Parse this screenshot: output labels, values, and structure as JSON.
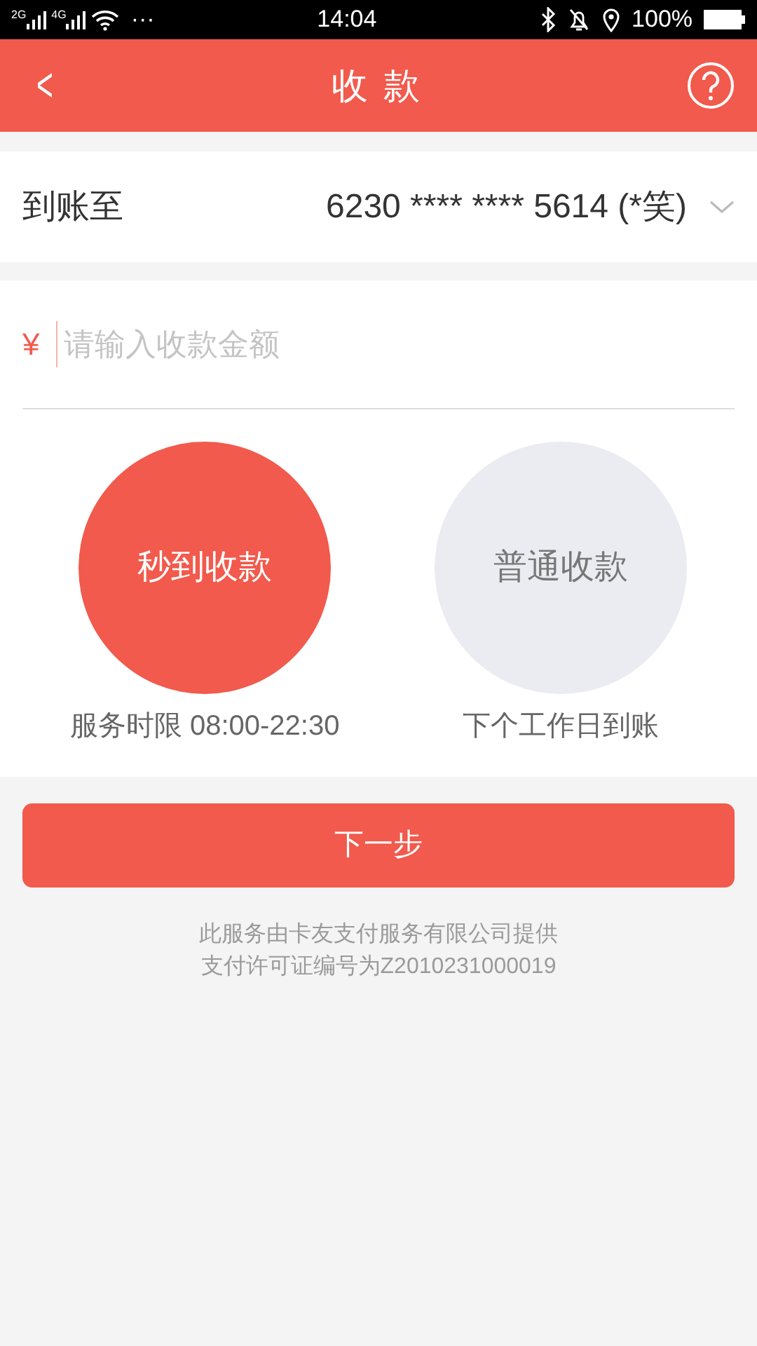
{
  "status_bar": {
    "networks": [
      "2G",
      "4G"
    ],
    "more": "···",
    "time": "14:04",
    "battery": "100%"
  },
  "header": {
    "back": "<",
    "title": "收 款"
  },
  "account": {
    "label": "到账至",
    "value": "6230 **** **** 5614 (*笑)"
  },
  "amount": {
    "currency": "¥",
    "placeholder": "请输入收款金额"
  },
  "options": [
    {
      "label": "秒到收款",
      "caption": "服务时限 08:00-22:30",
      "selected": true
    },
    {
      "label": "普通收款",
      "caption": "下个工作日到账",
      "selected": false
    }
  ],
  "next_button": "下一步",
  "footer": [
    "此服务由卡友支付服务有限公司提供",
    "支付许可证编号为Z2010231000019"
  ]
}
